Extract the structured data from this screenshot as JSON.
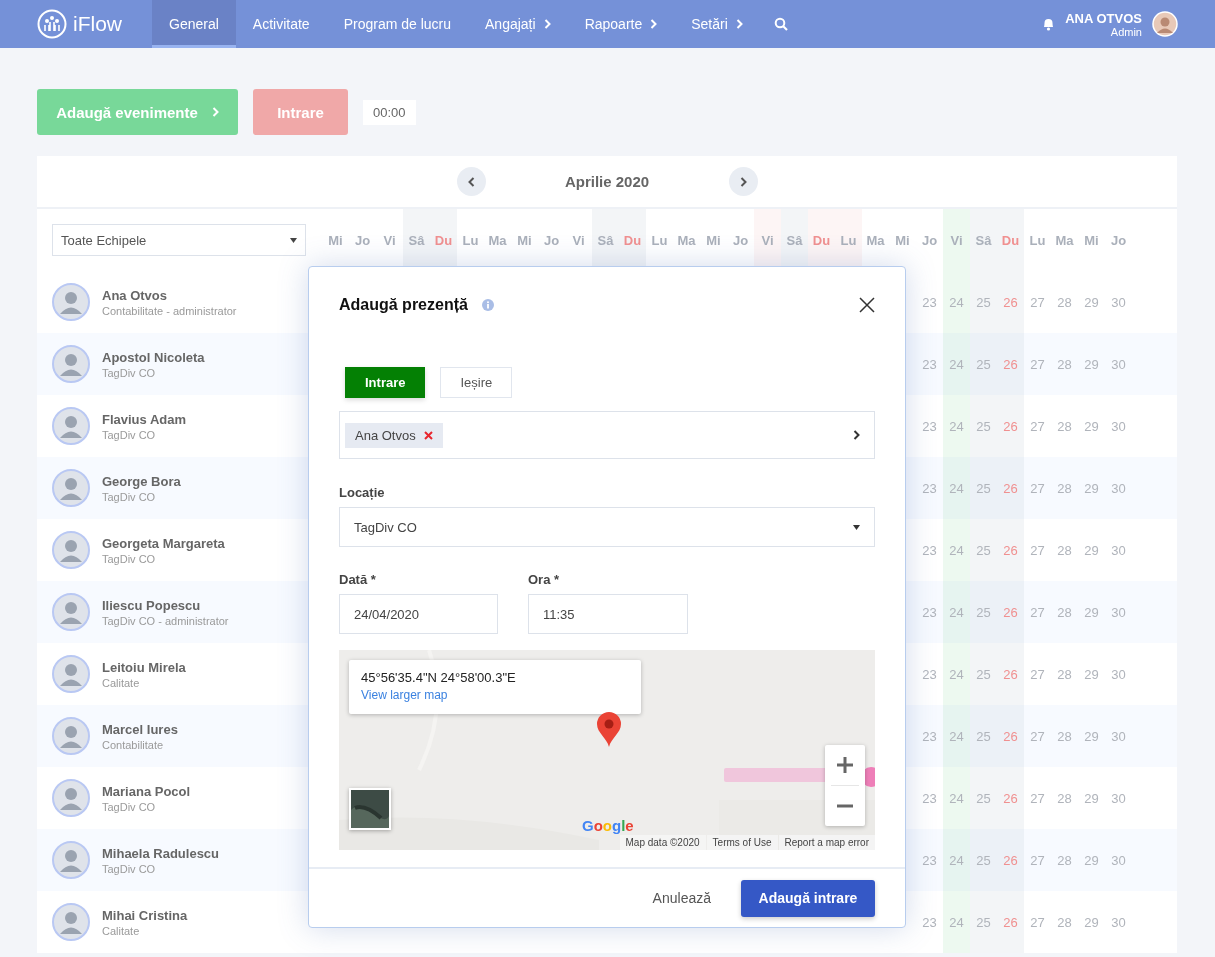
{
  "nav": {
    "brand": "iFlow",
    "items": [
      {
        "label": "General",
        "selected": true,
        "has_menu": false
      },
      {
        "label": "Activitate",
        "selected": false,
        "has_menu": false
      },
      {
        "label": "Program de lucru",
        "selected": false,
        "has_menu": false
      },
      {
        "label": "Angajați",
        "selected": false,
        "has_menu": true
      },
      {
        "label": "Rapoarte",
        "selected": false,
        "has_menu": true
      },
      {
        "label": "Setări",
        "selected": false,
        "has_menu": true
      }
    ],
    "user": {
      "name": "ANA OTVOS",
      "role": "Admin"
    }
  },
  "actions": {
    "add_events": "Adaugă evenimente",
    "clock_in": "Intrare",
    "timer": "00:00"
  },
  "calendar": {
    "month": "Aprilie 2020",
    "team_filter": "Toate Echipele",
    "days": [
      {
        "label": "Mi",
        "kind": "normal",
        "sunday": false
      },
      {
        "label": "Jo",
        "kind": "normal",
        "sunday": false
      },
      {
        "label": "Vi",
        "kind": "normal",
        "sunday": false
      },
      {
        "label": "Sâ",
        "kind": "weekend",
        "sunday": false
      },
      {
        "label": "Du",
        "kind": "weekend",
        "sunday": true
      },
      {
        "label": "Lu",
        "kind": "normal",
        "sunday": false
      },
      {
        "label": "Ma",
        "kind": "normal",
        "sunday": false
      },
      {
        "label": "Mi",
        "kind": "normal",
        "sunday": false
      },
      {
        "label": "Jo",
        "kind": "normal",
        "sunday": false
      },
      {
        "label": "Vi",
        "kind": "normal",
        "sunday": false
      },
      {
        "label": "Sâ",
        "kind": "weekend",
        "sunday": false
      },
      {
        "label": "Du",
        "kind": "weekend",
        "sunday": true
      },
      {
        "label": "Lu",
        "kind": "normal",
        "sunday": false
      },
      {
        "label": "Ma",
        "kind": "normal",
        "sunday": false
      },
      {
        "label": "Mi",
        "kind": "normal",
        "sunday": false
      },
      {
        "label": "Jo",
        "kind": "normal",
        "sunday": false
      },
      {
        "label": "Vi",
        "kind": "holiday",
        "sunday": false
      },
      {
        "label": "Sâ",
        "kind": "weekend",
        "sunday": false
      },
      {
        "label": "Du",
        "kind": "holiday",
        "sunday": true
      },
      {
        "label": "Lu",
        "kind": "holiday",
        "sunday": false
      },
      {
        "label": "Ma",
        "kind": "normal",
        "sunday": false
      },
      {
        "label": "Mi",
        "kind": "normal",
        "sunday": false
      },
      {
        "label": "Jo",
        "kind": "normal",
        "sunday": false
      },
      {
        "label": "Vi",
        "kind": "today",
        "sunday": false
      },
      {
        "label": "Sâ",
        "kind": "weekend",
        "sunday": false
      },
      {
        "label": "Du",
        "kind": "weekend",
        "sunday": true
      },
      {
        "label": "Lu",
        "kind": "normal",
        "sunday": false
      },
      {
        "label": "Ma",
        "kind": "normal",
        "sunday": false
      },
      {
        "label": "Mi",
        "kind": "normal",
        "sunday": false
      },
      {
        "label": "Jo",
        "kind": "normal",
        "sunday": false
      }
    ],
    "employees": [
      {
        "name": "Ana Otvos",
        "department": "Contabilitate - administrator",
        "days": [
          "23",
          "24",
          "25",
          "26",
          "27",
          "28",
          "29",
          "30"
        ]
      },
      {
        "name": "Apostol Nicoleta",
        "department": "TagDiv CO",
        "days": [
          "23",
          "24",
          "25",
          "26",
          "27",
          "28",
          "29",
          "30"
        ]
      },
      {
        "name": "Flavius Adam",
        "department": "TagDiv CO",
        "days": [
          "23",
          "24",
          "25",
          "26",
          "27",
          "28",
          "29",
          "30"
        ]
      },
      {
        "name": "George Bora",
        "department": "TagDiv CO",
        "days": [
          "23",
          "24",
          "25",
          "26",
          "27",
          "28",
          "29",
          "30"
        ]
      },
      {
        "name": "Georgeta Margareta",
        "department": "TagDiv CO",
        "days": [
          "23",
          "24",
          "25",
          "26",
          "27",
          "28",
          "29",
          "30"
        ]
      },
      {
        "name": "Iliescu Popescu",
        "department": "TagDiv CO - administrator",
        "days": [
          "23",
          "24",
          "25",
          "26",
          "27",
          "28",
          "29",
          "30"
        ]
      },
      {
        "name": "Leitoiu Mirela",
        "department": "Calitate",
        "days": [
          "23",
          "24",
          "25",
          "26",
          "27",
          "28",
          "29",
          "30"
        ]
      },
      {
        "name": "Marcel Iures",
        "department": "Contabilitate",
        "days": [
          "23",
          "24",
          "25",
          "26",
          "27",
          "28",
          "29",
          "30"
        ]
      },
      {
        "name": "Mariana Pocol",
        "department": "TagDiv CO",
        "days": [
          "23",
          "24",
          "25",
          "26",
          "27",
          "28",
          "29",
          "30"
        ]
      },
      {
        "name": "Mihaela Radulescu",
        "department": "TagDiv CO",
        "days": [
          "23",
          "24",
          "25",
          "26",
          "27",
          "28",
          "29",
          "30"
        ]
      },
      {
        "name": "Mihai Cristina",
        "department": "Calitate",
        "days": [
          "23",
          "24",
          "25",
          "26",
          "27",
          "28",
          "29",
          "30"
        ]
      }
    ]
  },
  "modal": {
    "title": "Adaugă prezență",
    "tabs": [
      {
        "label": "Intrare",
        "selected": true
      },
      {
        "label": "Ieșire",
        "selected": false
      }
    ],
    "employee_tags": [
      "Ana Otvos"
    ],
    "location": {
      "label": "Locație",
      "value": "TagDiv CO"
    },
    "date": {
      "label": "Dată *",
      "value": "24/04/2020"
    },
    "time": {
      "label": "Ora *",
      "value": "11:35"
    },
    "map": {
      "coordinates": "45°56'35.4\"N 24°58'00.3\"E",
      "link": "View larger map",
      "logo": "Google",
      "attribution": [
        "Map data ©2020",
        "Terms of Use",
        "Report a map error"
      ]
    },
    "cancel": "Anulează",
    "submit": "Adaugă intrare"
  }
}
